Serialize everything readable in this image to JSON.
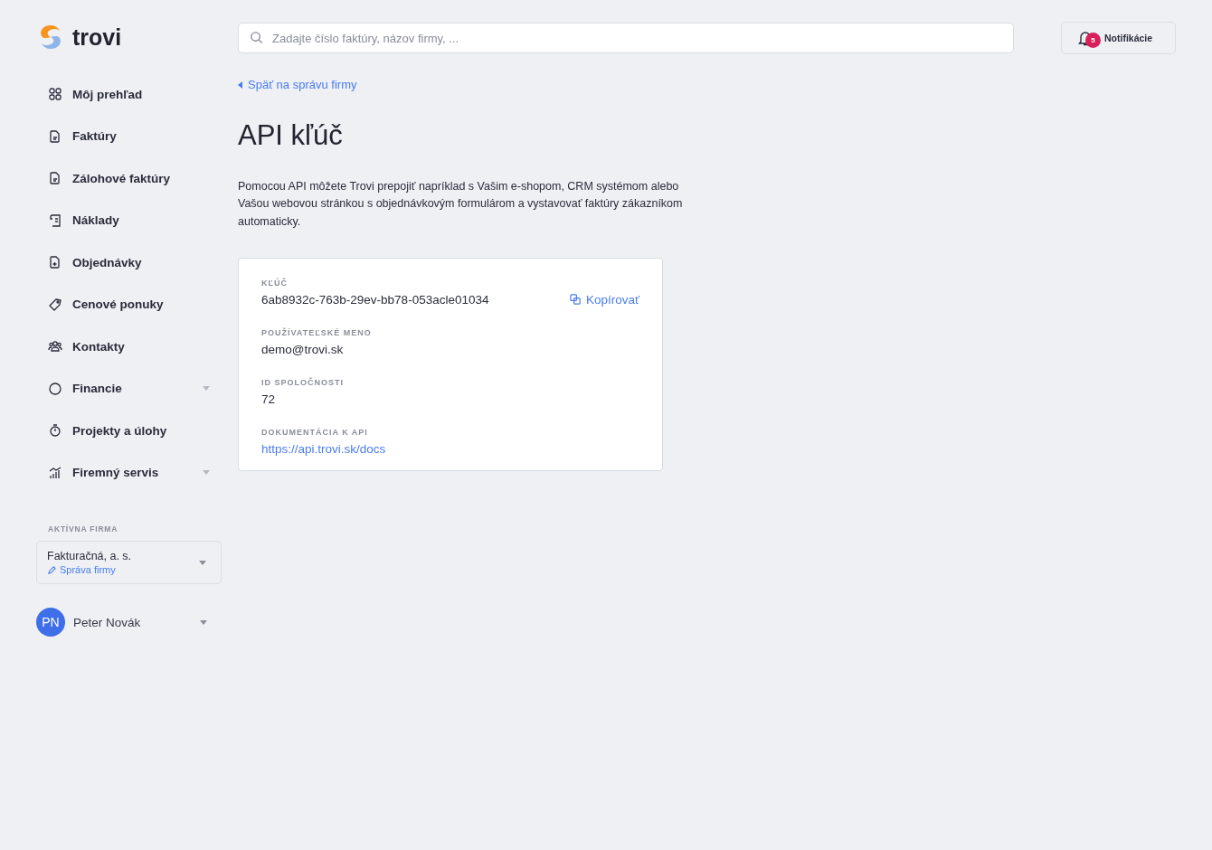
{
  "logo": {
    "text": "trovi"
  },
  "search": {
    "placeholder": "Zadajte číslo faktúry, názov firmy, ..."
  },
  "notifications": {
    "label": "Notifikácie",
    "count": "5"
  },
  "nav": [
    {
      "label": "Môj prehľad",
      "kind": "grid",
      "has_submenu": false
    },
    {
      "label": "Faktúry",
      "kind": "document",
      "has_submenu": false
    },
    {
      "label": "Zálohové faktúry",
      "kind": "document",
      "has_submenu": false
    },
    {
      "label": "Náklady",
      "kind": "receipt",
      "has_submenu": false
    },
    {
      "label": "Objednávky",
      "kind": "order",
      "has_submenu": false
    },
    {
      "label": "Cenové ponuky",
      "kind": "tag",
      "has_submenu": false
    },
    {
      "label": "Kontakty",
      "kind": "people",
      "has_submenu": false
    },
    {
      "label": "Financie",
      "kind": "circle",
      "has_submenu": true
    },
    {
      "label": "Projekty a úlohy",
      "kind": "stopwatch",
      "has_submenu": false
    },
    {
      "label": "Firemný servis",
      "kind": "chart",
      "has_submenu": true
    }
  ],
  "active_company": {
    "heading": "AKTÍVNA FIRMA",
    "name": "Fakturačná, a. s.",
    "manage_link": "Správa firmy"
  },
  "user": {
    "initials": "PN",
    "name": "Peter Novák"
  },
  "back_link": "Späť na správu firmy",
  "title": "API kľúč",
  "description": "Pomocou API môžete Trovi prepojiť napríklad s Vašim e-shopom, CRM systémom alebo Vašou webovou stránkou s objednávkovým formulárom a vystavovať faktúry zákazníkom automaticky.",
  "fields": [
    {
      "label": "KĽÚČ",
      "value": "6ab8932c-763b-29ev-bb78-053acle01034",
      "kind": "text",
      "action": "Kopírovať"
    },
    {
      "label": "POUŽÍVATEĽSKÉ MENO",
      "value": "demo@trovi.sk",
      "kind": "text"
    },
    {
      "label": "ID SPOLOČNOSTI",
      "value": "72",
      "kind": "text"
    },
    {
      "label": "DOKUMENTÁCIA K API",
      "value": "https://api.trovi.sk/docs",
      "kind": "link"
    }
  ]
}
